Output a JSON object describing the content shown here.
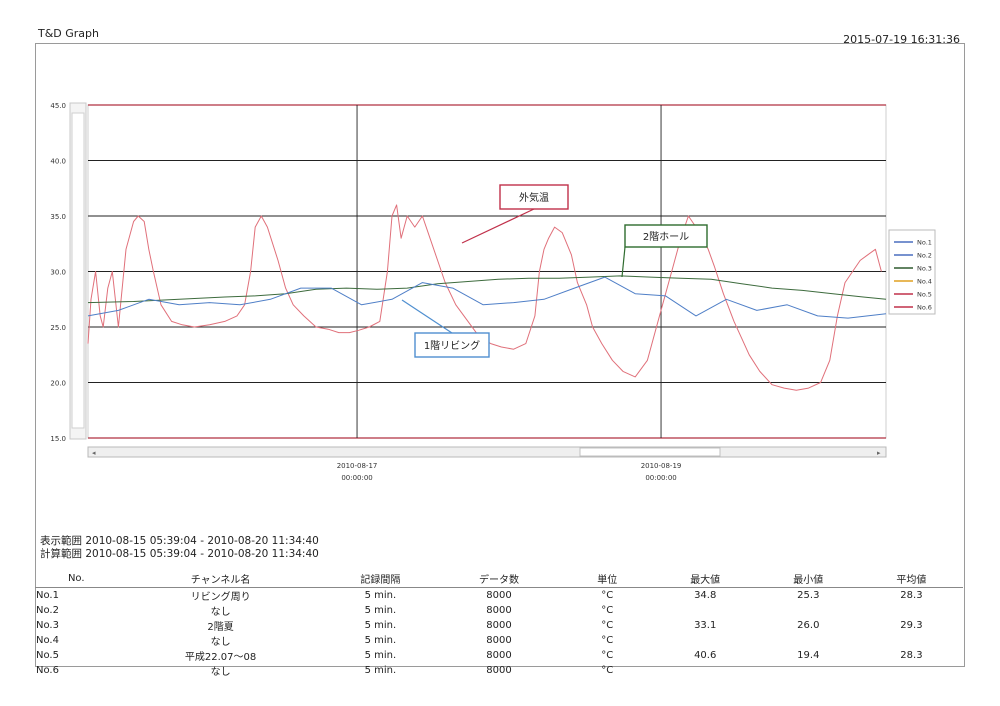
{
  "header": {
    "title": "T&D Graph",
    "printed": "2015-07-19 16:31:36"
  },
  "display_range": "表示範囲 2010-08-15 05:39:04 - 2010-08-20 11:34:40",
  "calc_range": "計算範囲 2010-08-15 05:39:04 - 2010-08-20 11:34:40",
  "table": {
    "headers": [
      "No.",
      "チャンネル名",
      "記録間隔",
      "データ数",
      "単位",
      "最大値",
      "最小値",
      "平均値"
    ],
    "rows": [
      [
        "No.1",
        "リビング周り",
        "5 min.",
        "8000",
        "°C",
        "34.8",
        "25.3",
        "28.3"
      ],
      [
        "No.2",
        "なし",
        "5 min.",
        "8000",
        "°C",
        "",
        "",
        ""
      ],
      [
        "No.3",
        "2階夏",
        "5 min.",
        "8000",
        "°C",
        "33.1",
        "26.0",
        "29.3"
      ],
      [
        "No.4",
        "なし",
        "5 min.",
        "8000",
        "°C",
        "",
        "",
        ""
      ],
      [
        "No.5",
        "平成22.07～08",
        "5 min.",
        "8000",
        "°C",
        "40.6",
        "19.4",
        "28.3"
      ],
      [
        "No.6",
        "なし",
        "5 min.",
        "8000",
        "°C",
        "",
        "",
        ""
      ]
    ]
  },
  "chart_data": {
    "type": "line",
    "ylim": [
      15,
      45
    ],
    "yticks": [
      "15.0",
      "20.0",
      "25.0",
      "30.0",
      "35.0",
      "40.0",
      "45.0"
    ],
    "xlim": [
      0,
      5.25
    ],
    "xticks": [
      {
        "x": 1.77,
        "date": "2010-08-17",
        "time": "00:00:00"
      },
      {
        "x": 3.77,
        "date": "2010-08-19",
        "time": "00:00:00"
      }
    ],
    "legend_position": "right",
    "legend": [
      {
        "label": "No.1",
        "color": "#4a6fbf"
      },
      {
        "label": "No.2",
        "color": "#4a6fbf"
      },
      {
        "label": "No.3",
        "color": "#2e5a2e"
      },
      {
        "label": "No.4",
        "color": "#e0a020"
      },
      {
        "label": "No.5",
        "color": "#c0304a"
      },
      {
        "label": "No.6",
        "color": "#c0304a"
      }
    ],
    "series": [
      {
        "name": "No.5",
        "color": "#e0707a",
        "x": [
          0,
          0.02,
          0.05,
          0.08,
          0.1,
          0.13,
          0.16,
          0.2,
          0.25,
          0.3,
          0.33,
          0.37,
          0.4,
          0.43,
          0.48,
          0.55,
          0.62,
          0.7,
          0.8,
          0.9,
          0.98,
          1.03,
          1.07,
          1.1,
          1.14,
          1.18,
          1.25,
          1.3,
          1.35,
          1.42,
          1.5,
          1.58,
          1.65,
          1.72,
          1.78,
          1.85,
          1.92,
          1.97,
          2.0,
          2.03,
          2.06,
          2.1,
          2.15,
          2.2,
          2.25,
          2.3,
          2.35,
          2.42,
          2.5,
          2.58,
          2.65,
          2.72,
          2.8,
          2.88,
          2.94,
          2.97,
          3.0,
          3.03,
          3.07,
          3.12,
          3.18,
          3.22,
          3.28,
          3.32,
          3.38,
          3.45,
          3.52,
          3.6,
          3.68,
          3.76,
          3.84,
          3.9,
          3.95,
          4.0,
          4.04,
          4.08,
          4.12,
          4.18,
          4.25,
          4.3,
          4.35,
          4.42,
          4.5,
          4.58,
          4.66,
          4.74,
          4.82,
          4.88,
          4.93,
          4.98,
          5.03,
          5.08,
          5.13,
          5.18,
          5.22
        ],
        "y": [
          23.5,
          27.5,
          30.0,
          26.0,
          25.0,
          28.5,
          30.0,
          25.0,
          32.0,
          34.5,
          35.0,
          34.5,
          32.0,
          30.0,
          27.0,
          25.5,
          25.2,
          25.0,
          25.2,
          25.5,
          26.0,
          27.0,
          30.0,
          34.0,
          35.0,
          34.0,
          31.0,
          28.5,
          27.0,
          26.0,
          25.0,
          24.8,
          24.5,
          24.5,
          24.7,
          25.0,
          25.5,
          30.0,
          35.0,
          36.0,
          33.0,
          35.0,
          34.0,
          35.0,
          33.0,
          31.0,
          29.0,
          27.0,
          25.5,
          24.0,
          23.5,
          23.2,
          23.0,
          23.5,
          26.0,
          30.0,
          32.0,
          33.0,
          34.0,
          33.5,
          31.5,
          29.0,
          27.0,
          25.0,
          23.5,
          22.0,
          21.0,
          20.5,
          22.0,
          26.0,
          30.0,
          33.0,
          35.0,
          34.0,
          33.0,
          32.0,
          30.5,
          28.0,
          25.5,
          24.0,
          22.5,
          21.0,
          19.8,
          19.5,
          19.3,
          19.5,
          20.0,
          22.0,
          26.0,
          29.0,
          30.0,
          31.0,
          31.5,
          32.0,
          30.0
        ]
      },
      {
        "name": "No.3",
        "color": "#3d6b3d",
        "x": [
          0,
          0.3,
          0.6,
          0.9,
          1.1,
          1.3,
          1.5,
          1.7,
          1.9,
          2.1,
          2.3,
          2.5,
          2.7,
          2.9,
          3.1,
          3.3,
          3.5,
          3.7,
          3.9,
          4.1,
          4.3,
          4.5,
          4.7,
          4.9,
          5.1,
          5.25
        ],
        "y": [
          27.2,
          27.3,
          27.5,
          27.7,
          27.8,
          28.0,
          28.4,
          28.5,
          28.4,
          28.5,
          28.9,
          29.1,
          29.3,
          29.4,
          29.4,
          29.5,
          29.6,
          29.5,
          29.4,
          29.3,
          28.9,
          28.5,
          28.3,
          28.0,
          27.7,
          27.5
        ]
      },
      {
        "name": "No.1",
        "color": "#4f7fc7",
        "x": [
          0,
          0.2,
          0.4,
          0.6,
          0.8,
          1.0,
          1.2,
          1.4,
          1.6,
          1.8,
          2.0,
          2.2,
          2.4,
          2.6,
          2.8,
          3.0,
          3.2,
          3.4,
          3.6,
          3.8,
          4.0,
          4.2,
          4.4,
          4.6,
          4.8,
          5.0,
          5.25
        ],
        "y": [
          26.0,
          26.5,
          27.5,
          27.0,
          27.2,
          27.0,
          27.5,
          28.5,
          28.5,
          27.0,
          27.5,
          29.0,
          28.5,
          27.0,
          27.2,
          27.5,
          28.5,
          29.5,
          28.0,
          27.8,
          26.0,
          27.5,
          26.5,
          27.0,
          26.0,
          25.8,
          26.2
        ]
      }
    ],
    "annotations": [
      {
        "text": "外気温",
        "box_color": "#c0304a",
        "x": 2.12,
        "y": 32.8
      },
      {
        "text": "2階ホール",
        "box_color": "#2e6b2e",
        "x": 3.45,
        "y": 29.7
      },
      {
        "text": "1階リビング",
        "box_color": "#4f8fd0",
        "x": 2.12,
        "y": 26.8
      }
    ]
  }
}
